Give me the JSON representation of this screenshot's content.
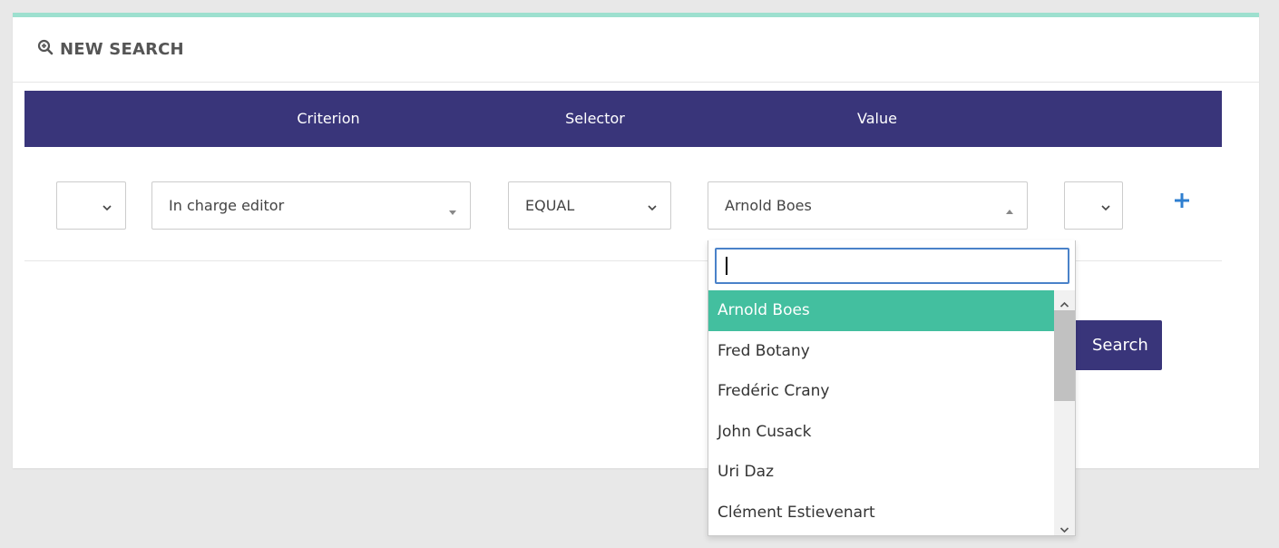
{
  "panel": {
    "title": "NEW SEARCH",
    "title_icon": "zoom-in-icon",
    "accent_color": "#9de0cf"
  },
  "table": {
    "header_bg": "#39357a",
    "headers": [
      "Criterion",
      "Selector",
      "Value"
    ]
  },
  "row": {
    "criterion": {
      "value": "In charge editor"
    },
    "selector": {
      "value": "EQUAL"
    },
    "value": {
      "value": "Arnold Boes"
    },
    "add_icon": "plus-icon"
  },
  "search_button": {
    "label": "Search",
    "icon": "search-icon"
  },
  "dropdown": {
    "search_value": "",
    "highlight_color": "#43bf9f",
    "options": [
      {
        "label": "Arnold Boes",
        "active": true
      },
      {
        "label": "Fred Botany",
        "active": false
      },
      {
        "label": "Fredéric Crany",
        "active": false
      },
      {
        "label": "John Cusack",
        "active": false
      },
      {
        "label": "Uri Daz",
        "active": false
      },
      {
        "label": "Clément Estievenart",
        "active": false
      }
    ]
  }
}
